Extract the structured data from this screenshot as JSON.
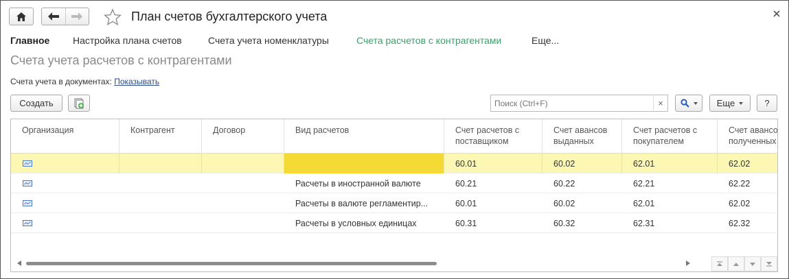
{
  "window": {
    "title": "План счетов бухгалтерского учета"
  },
  "tabs": {
    "main": "Главное",
    "plan_settings": "Настройка плана счетов",
    "nomenclature": "Счета учета номенклатуры",
    "counterparties": "Счета расчетов с контрагентами",
    "more": "Еще..."
  },
  "section": {
    "title": "Счета учета расчетов с контрагентами"
  },
  "docs": {
    "label": "Счета учета в документах:",
    "link": "Показывать"
  },
  "toolbar": {
    "create_label": "Создать",
    "search_placeholder": "Поиск (Ctrl+F)",
    "clear_label": "×",
    "more_label": "Еще",
    "help_label": "?"
  },
  "table": {
    "columns": [
      "Организация",
      "Контрагент",
      "Договор",
      "Вид расчетов",
      "Счет расчетов с поставщиком",
      "Счет авансов выданных",
      "Счет расчетов с покупателем",
      "Счет авансов полученных"
    ],
    "rows": [
      {
        "organization": "",
        "counterparty": "",
        "contract": "",
        "vid": "",
        "sup": "60.01",
        "adv_out": "60.02",
        "buy": "62.01",
        "adv_in": "62.02"
      },
      {
        "organization": "",
        "counterparty": "",
        "contract": "",
        "vid": "Расчеты в иностранной валюте",
        "sup": "60.21",
        "adv_out": "60.22",
        "buy": "62.21",
        "adv_in": "62.22"
      },
      {
        "organization": "",
        "counterparty": "",
        "contract": "",
        "vid": "Расчеты в валюте регламентир...",
        "sup": "60.01",
        "adv_out": "60.02",
        "buy": "62.01",
        "adv_in": "62.02"
      },
      {
        "organization": "",
        "counterparty": "",
        "contract": "",
        "vid": "Расчеты в условных единицах",
        "sup": "60.31",
        "adv_out": "60.32",
        "buy": "62.31",
        "adv_in": "62.32"
      }
    ]
  },
  "colors": {
    "active_tab": "#3aa06a",
    "selected_row": "#fcf8b3",
    "selected_cell": "#f5d935",
    "link": "#2a4a8a"
  }
}
